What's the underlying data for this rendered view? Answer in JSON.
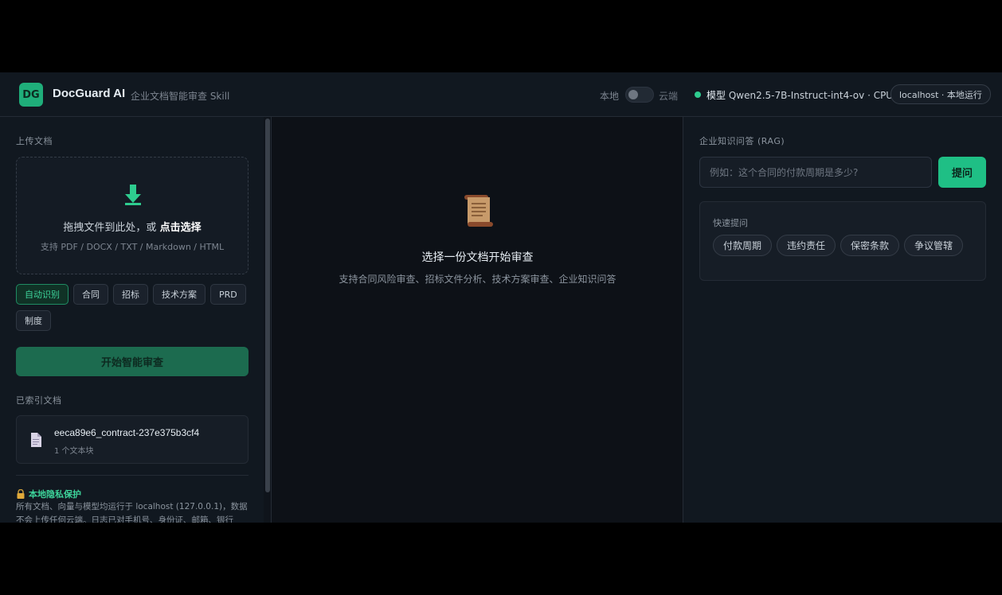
{
  "header": {
    "logo_text": "DG",
    "title": "DocGuard AI",
    "subtitle": "企业文档智能审查 Skill",
    "mode_local": "本地",
    "mode_cloud": "云端",
    "model_prefix": "模型",
    "model_name": "Qwen2.5-7B-Instruct-int4-ov · CPU",
    "host_badge": "localhost · 本地运行",
    "status_color": "#2ecc8f"
  },
  "left": {
    "upload_label": "上传文档",
    "drop_text": "拖拽文件到此处，或 ",
    "drop_link": "点击选择",
    "drop_hint": "支持 PDF / DOCX / TXT / Markdown / HTML",
    "types": [
      "自动识别",
      "合同",
      "招标",
      "技术方案",
      "PRD",
      "制度"
    ],
    "active_type": "自动识别",
    "start_button": "开始智能审查",
    "indexed_label": "已索引文档",
    "documents": [
      {
        "name": "eeca89e6_contract-237e375b3cf4",
        "meta": "1 个文本块"
      }
    ],
    "privacy_title": "本地隐私保护",
    "privacy_text": "所有文档、向量与模型均运行于 localhost (127.0.0.1)，数据不会上传任何云端。日志已对手机号、身份证、邮箱、银行"
  },
  "center": {
    "icon": "scroll-icon",
    "empty_title": "选择一份文档开始审查",
    "empty_desc": "支持合同风险审查、招标文件分析、技术方案审查、企业知识问答"
  },
  "right": {
    "rag_label": "企业知识问答 (RAG)",
    "input_placeholder": "例如：这个合同的付款周期是多少?",
    "ask_button": "提问",
    "quick_label": "快速提问",
    "quick_questions": [
      "付款周期",
      "违约责任",
      "保密条款",
      "争议管辖"
    ]
  },
  "colors": {
    "accent": "#1fbf85",
    "background": "#0d1117",
    "panel": "#111820"
  }
}
